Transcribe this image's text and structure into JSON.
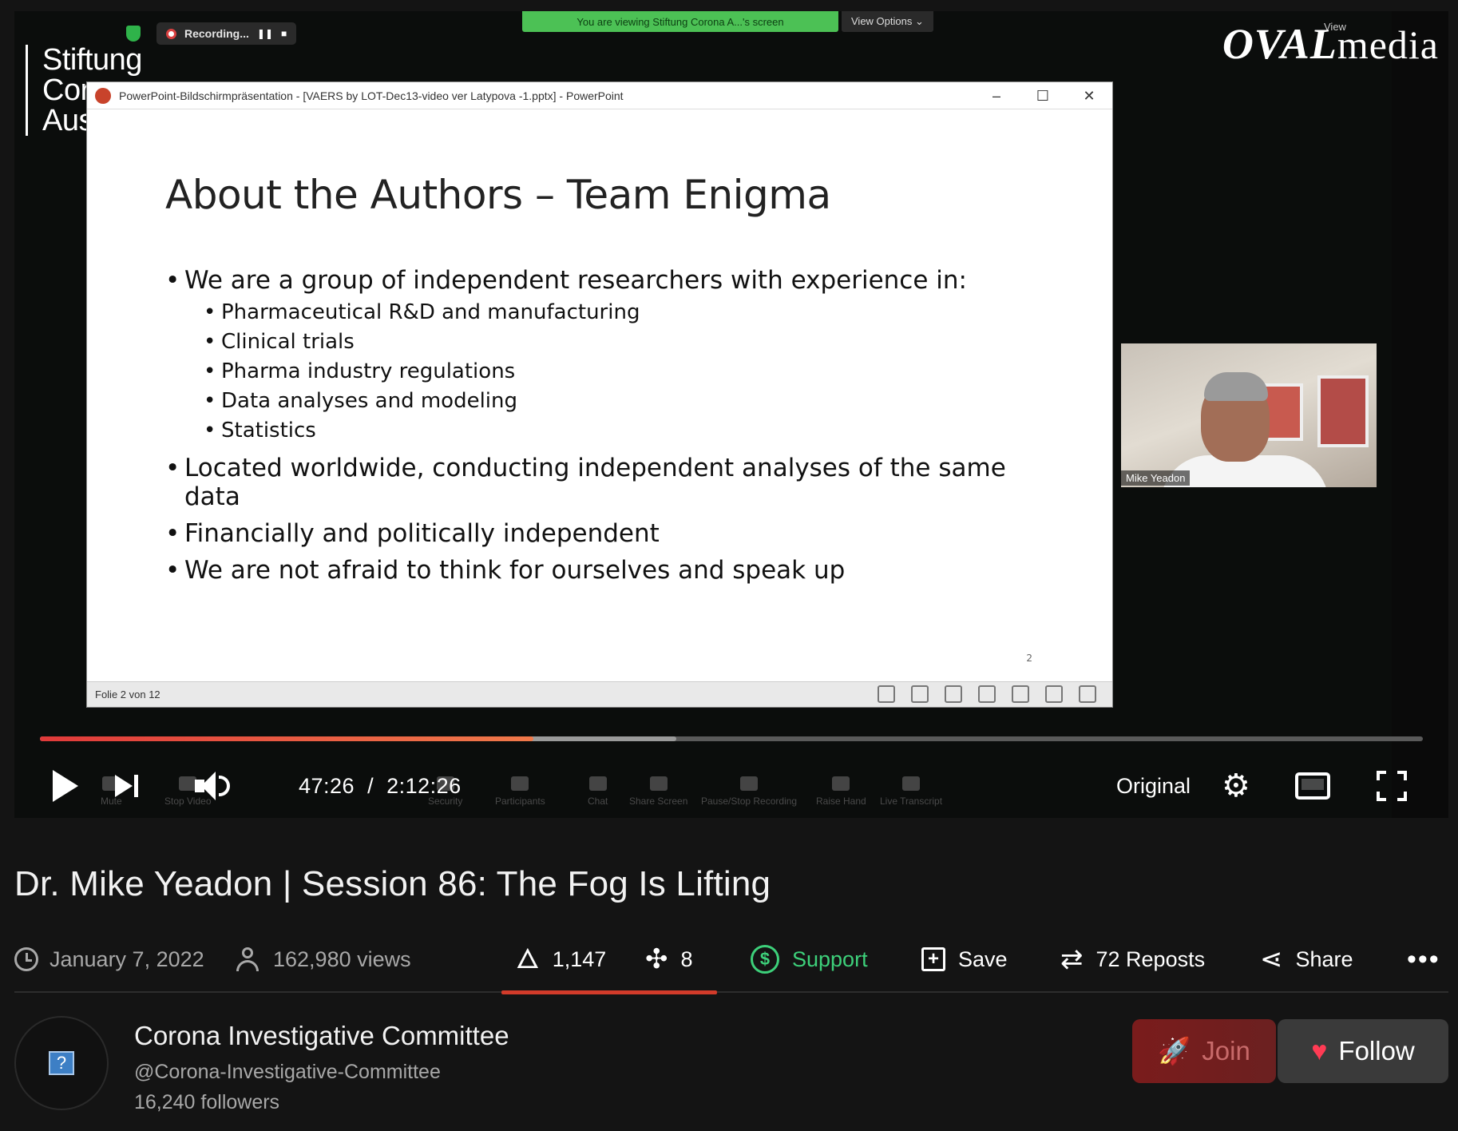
{
  "player": {
    "overlay": {
      "stiftung_lines": [
        "Stiftung",
        "Cor",
        "Aus"
      ],
      "oval_brand": "OVAL",
      "oval_media": "media",
      "recording_label": "Recording...",
      "viewing_banner": "You are viewing Stiftung Corona A...'s screen",
      "view_options": "View Options ⌄",
      "zoom_view": "View"
    },
    "ppt": {
      "window_title": "PowerPoint-Bildschirmpräsentation - [VAERS by LOT-Dec13-video ver Latypova -1.pptx] - PowerPoint",
      "slide_title": "About the Authors – Team Enigma",
      "bullets": [
        {
          "text": "We are a group of independent researchers with experience in:",
          "sub": [
            "Pharmaceutical R&D and manufacturing",
            "Clinical trials",
            "Pharma industry regulations",
            "Data analyses and modeling",
            "Statistics"
          ]
        },
        {
          "text": "Located worldwide, conducting independent analyses of the same data",
          "sub": []
        },
        {
          "text": "Financially and politically independent",
          "sub": []
        },
        {
          "text": "We are not afraid to think for ourselves and speak up",
          "sub": []
        }
      ],
      "slide_number": "2",
      "status_text": "Folie 2 von 12"
    },
    "participant_name": "Mike Yeadon",
    "zoom_toolbar": [
      "Mute",
      "Stop Video",
      "Security",
      "Participants",
      "Chat",
      "Share Screen",
      "Pause/Stop Recording",
      "Raise Hand",
      "Live Transcript"
    ],
    "progress": {
      "played_fraction": 0.3566,
      "buffered_fraction": 0.36
    },
    "current_time": "47:26",
    "separator": "/",
    "duration": "2:12:26",
    "quality": "Original"
  },
  "video": {
    "title": "Dr. Mike Yeadon | Session 86: The Fog Is Lifting",
    "date": "January 7, 2022",
    "views": "162,980 views"
  },
  "actions": {
    "rumbles": "1,147",
    "boosts": "8",
    "support": "Support",
    "save": "Save",
    "reposts": "72 Reposts",
    "share": "Share",
    "more": "•••"
  },
  "channel": {
    "name": "Corona Investigative Committee",
    "handle": "@Corona-Investigative-Committee",
    "followers": "16,240 followers",
    "join_label": "Join",
    "follow_label": "Follow"
  },
  "colors": {
    "accent_red": "#d23b2a",
    "support_green": "#3dd07a",
    "zoom_green": "#4cc155",
    "heart": "#ff3b54"
  },
  "icons": {
    "play": "play-icon",
    "next": "skip-next-icon",
    "volume": "volume-icon",
    "settings": "gear-icon",
    "theater": "theater-mode-icon",
    "fullscreen": "fullscreen-icon",
    "date": "clock-icon",
    "views": "people-icon",
    "rumbles": "flame-icon",
    "boosts": "boost-icon",
    "support": "dollar-coin-icon",
    "save": "add-to-playlist-icon",
    "reposts": "repost-icon",
    "share": "share-icon",
    "more": "more-icon",
    "join": "rocket-icon",
    "follow": "heart-icon"
  }
}
